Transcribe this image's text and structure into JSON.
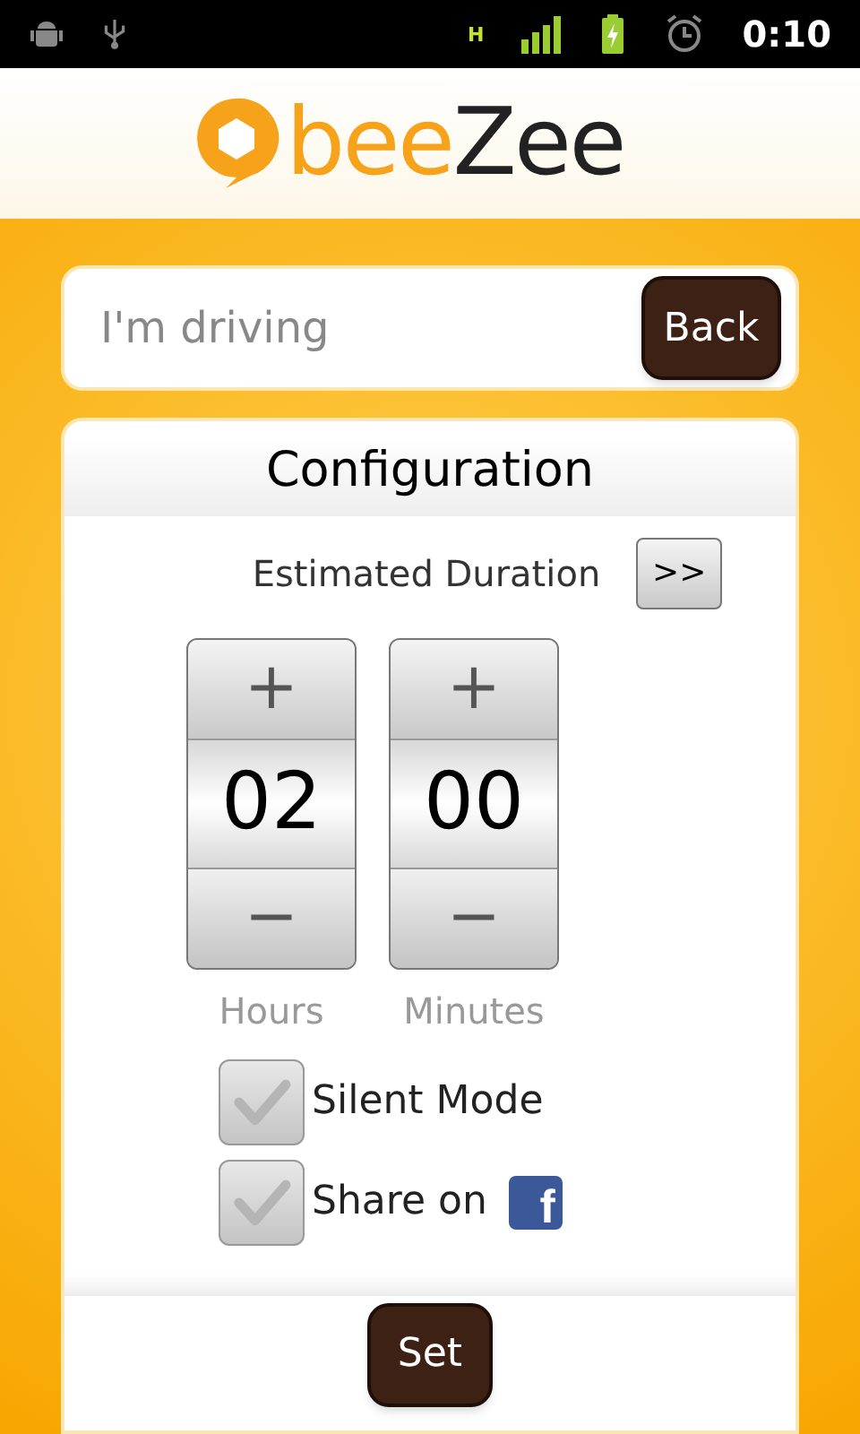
{
  "status_bar": {
    "network_type": "H",
    "time": "0:10"
  },
  "logo": {
    "part_1": "bee",
    "part_2": "Zee"
  },
  "mode_field": {
    "placeholder": "I'm driving"
  },
  "back_button": "Back",
  "config": {
    "title": "Configuration",
    "duration_label": "Estimated Duration",
    "expand_button": ">>",
    "pickers": [
      {
        "value": "02",
        "label": "Hours",
        "increment": "+",
        "decrement": "−"
      },
      {
        "value": "00",
        "label": "Minutes",
        "increment": "+",
        "decrement": "−"
      }
    ],
    "options": [
      {
        "kind": "plain",
        "label": "Silent Mode",
        "checked": false
      },
      {
        "kind": "facebook",
        "label": "Share on",
        "glyph": "f",
        "checked": false
      }
    ],
    "set_button": "Set"
  }
}
